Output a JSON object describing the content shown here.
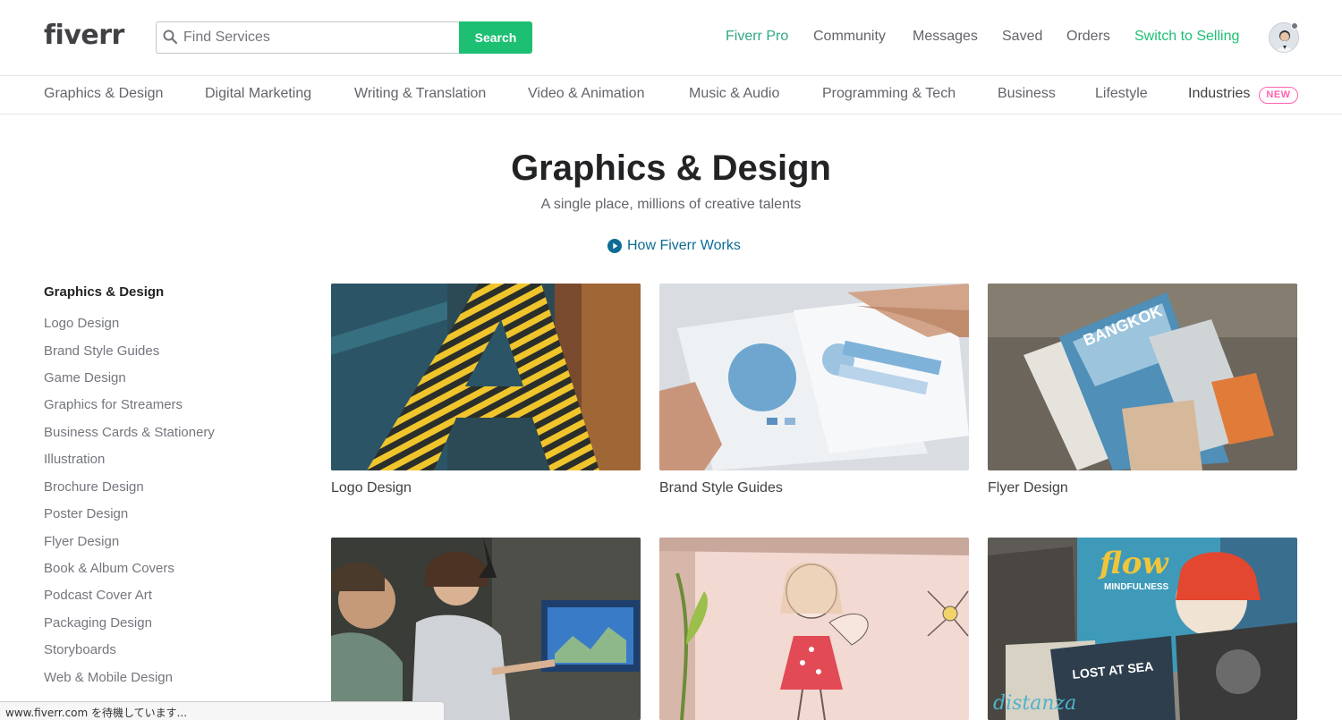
{
  "header": {
    "logo": "fiverr",
    "search": {
      "placeholder": "Find Services",
      "button_label": "Search"
    },
    "nav": [
      "Fiverr Pro",
      "Community",
      "Messages",
      "Saved",
      "Orders",
      "Switch to Selling"
    ]
  },
  "categories": [
    "Graphics & Design",
    "Digital Marketing",
    "Writing & Translation",
    "Video & Animation",
    "Music & Audio",
    "Programming & Tech",
    "Business",
    "Lifestyle",
    "Industries"
  ],
  "new_badge": "NEW",
  "hero": {
    "title": "Graphics & Design",
    "subtitle": "A single place, millions of creative talents",
    "how_link": "How Fiverr Works"
  },
  "sidebar": {
    "title": "Graphics & Design",
    "items": [
      "Logo Design",
      "Brand Style Guides",
      "Game Design",
      "Graphics for Streamers",
      "Business Cards & Stationery",
      "Illustration",
      "Brochure Design",
      "Poster Design",
      "Flyer Design",
      "Book & Album Covers",
      "Podcast Cover Art",
      "Packaging Design",
      "Storyboards",
      "Web & Mobile Design"
    ]
  },
  "cards": [
    {
      "label": "Logo Design"
    },
    {
      "label": "Brand Style Guides"
    },
    {
      "label": "Flyer Design"
    },
    {
      "label": ""
    },
    {
      "label": ""
    },
    {
      "label": ""
    }
  ],
  "card_texts": {
    "flyer_word": "BANGKOK",
    "flow_word": "flow",
    "mindfulness": "MINDFULNESS",
    "lost_at_sea": "LOST AT SEA",
    "distanza": "distanza"
  },
  "status_bar": "www.fiverr.com を待機しています...",
  "colors": {
    "brand_green": "#1dbf73",
    "link_blue": "#0d6c94",
    "new_pink": "#ff62ad"
  }
}
